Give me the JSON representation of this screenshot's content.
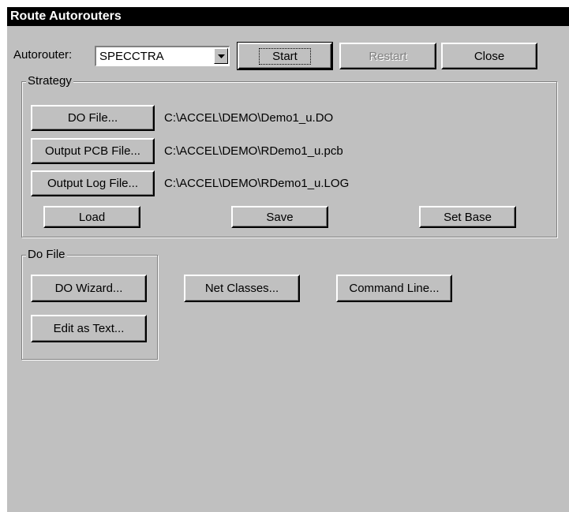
{
  "window": {
    "title": "Route Autorouters"
  },
  "toolbar": {
    "autorouter_label": "Autorouter:",
    "autorouter_value": "SPECCTRA",
    "start_label": "Start",
    "restart_label": "Restart",
    "close_label": "Close"
  },
  "strategy": {
    "title": "Strategy",
    "do_file_button": "DO File...",
    "do_file_path": "C:\\ACCEL\\DEMO\\Demo1_u.DO",
    "output_pcb_button": "Output PCB File...",
    "output_pcb_path": "C:\\ACCEL\\DEMO\\RDemo1_u.pcb",
    "output_log_button": "Output Log File...",
    "output_log_path": "C:\\ACCEL\\DEMO\\RDemo1_u.LOG",
    "load_button": "Load",
    "save_button": "Save",
    "set_base_button": "Set Base"
  },
  "do_file": {
    "title": "Do File",
    "do_wizard_button": "DO Wizard...",
    "edit_as_text_button": "Edit as Text...",
    "net_classes_button": "Net Classes...",
    "command_line_button": "Command Line..."
  },
  "colors": {
    "face": "#c0c0c0",
    "title_bar": "#000000",
    "disabled_text": "#808080"
  },
  "icons": {
    "combo_arrow": "triangle-down-icon"
  }
}
